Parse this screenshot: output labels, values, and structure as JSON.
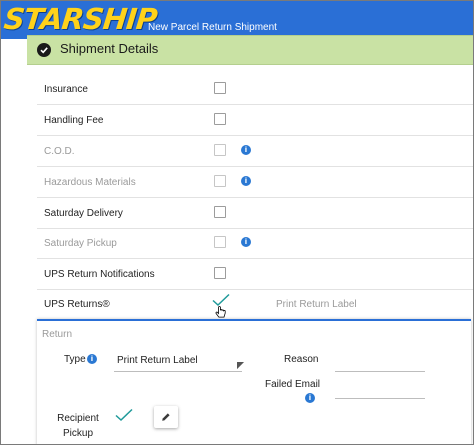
{
  "header": {
    "logo_text": "STARSHIP",
    "title": "New Parcel Return Shipment",
    "bar_color": "#2a6fd6",
    "logo_color": "#ffd21a"
  },
  "section": {
    "title": "Shipment Details",
    "header_color": "#c9e2a4",
    "icon": "check-circle-icon"
  },
  "options": [
    {
      "label": "Insurance",
      "checked": false,
      "enabled": true,
      "info": false
    },
    {
      "label": "Handling Fee",
      "checked": false,
      "enabled": true,
      "info": false
    },
    {
      "label": "C.O.D.",
      "checked": false,
      "enabled": false,
      "info": true
    },
    {
      "label": "Hazardous Materials",
      "checked": false,
      "enabled": false,
      "info": true
    },
    {
      "label": "Saturday Delivery",
      "checked": false,
      "enabled": true,
      "info": false
    },
    {
      "label": "Saturday Pickup",
      "checked": false,
      "enabled": false,
      "info": true
    },
    {
      "label": "UPS Return Notifications",
      "checked": false,
      "enabled": true,
      "info": false
    }
  ],
  "ups_returns": {
    "label": "UPS Returns®",
    "checked": true,
    "link_label": "Print Return Label",
    "check_color": "#1f9a9a"
  },
  "return_panel": {
    "title": "Return",
    "type_label": "Type",
    "type_value": "Print Return Label",
    "reason_label": "Reason",
    "reason_value": "",
    "failed_email_label": "Failed Email",
    "failed_email_value": "",
    "recipient_pickup_label": "Recipient Pickup",
    "recipient_pickup_checked": true,
    "edit_icon": "pencil-icon"
  },
  "info_icon_glyph": "i"
}
